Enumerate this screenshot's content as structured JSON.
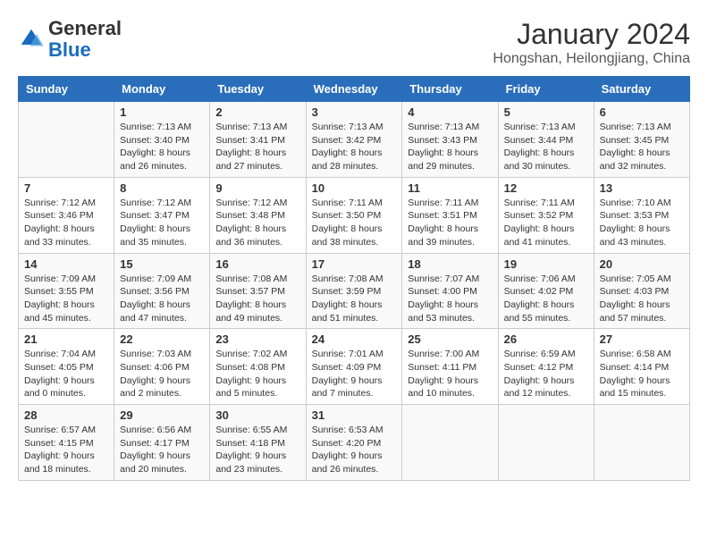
{
  "header": {
    "logo_line1": "General",
    "logo_line2": "Blue",
    "month": "January 2024",
    "location": "Hongshan, Heilongjiang, China"
  },
  "days_of_week": [
    "Sunday",
    "Monday",
    "Tuesday",
    "Wednesday",
    "Thursday",
    "Friday",
    "Saturday"
  ],
  "weeks": [
    [
      {
        "day": "",
        "info": ""
      },
      {
        "day": "1",
        "info": "Sunrise: 7:13 AM\nSunset: 3:40 PM\nDaylight: 8 hours\nand 26 minutes."
      },
      {
        "day": "2",
        "info": "Sunrise: 7:13 AM\nSunset: 3:41 PM\nDaylight: 8 hours\nand 27 minutes."
      },
      {
        "day": "3",
        "info": "Sunrise: 7:13 AM\nSunset: 3:42 PM\nDaylight: 8 hours\nand 28 minutes."
      },
      {
        "day": "4",
        "info": "Sunrise: 7:13 AM\nSunset: 3:43 PM\nDaylight: 8 hours\nand 29 minutes."
      },
      {
        "day": "5",
        "info": "Sunrise: 7:13 AM\nSunset: 3:44 PM\nDaylight: 8 hours\nand 30 minutes."
      },
      {
        "day": "6",
        "info": "Sunrise: 7:13 AM\nSunset: 3:45 PM\nDaylight: 8 hours\nand 32 minutes."
      }
    ],
    [
      {
        "day": "7",
        "info": "Sunrise: 7:12 AM\nSunset: 3:46 PM\nDaylight: 8 hours\nand 33 minutes."
      },
      {
        "day": "8",
        "info": "Sunrise: 7:12 AM\nSunset: 3:47 PM\nDaylight: 8 hours\nand 35 minutes."
      },
      {
        "day": "9",
        "info": "Sunrise: 7:12 AM\nSunset: 3:48 PM\nDaylight: 8 hours\nand 36 minutes."
      },
      {
        "day": "10",
        "info": "Sunrise: 7:11 AM\nSunset: 3:50 PM\nDaylight: 8 hours\nand 38 minutes."
      },
      {
        "day": "11",
        "info": "Sunrise: 7:11 AM\nSunset: 3:51 PM\nDaylight: 8 hours\nand 39 minutes."
      },
      {
        "day": "12",
        "info": "Sunrise: 7:11 AM\nSunset: 3:52 PM\nDaylight: 8 hours\nand 41 minutes."
      },
      {
        "day": "13",
        "info": "Sunrise: 7:10 AM\nSunset: 3:53 PM\nDaylight: 8 hours\nand 43 minutes."
      }
    ],
    [
      {
        "day": "14",
        "info": "Sunrise: 7:09 AM\nSunset: 3:55 PM\nDaylight: 8 hours\nand 45 minutes."
      },
      {
        "day": "15",
        "info": "Sunrise: 7:09 AM\nSunset: 3:56 PM\nDaylight: 8 hours\nand 47 minutes."
      },
      {
        "day": "16",
        "info": "Sunrise: 7:08 AM\nSunset: 3:57 PM\nDaylight: 8 hours\nand 49 minutes."
      },
      {
        "day": "17",
        "info": "Sunrise: 7:08 AM\nSunset: 3:59 PM\nDaylight: 8 hours\nand 51 minutes."
      },
      {
        "day": "18",
        "info": "Sunrise: 7:07 AM\nSunset: 4:00 PM\nDaylight: 8 hours\nand 53 minutes."
      },
      {
        "day": "19",
        "info": "Sunrise: 7:06 AM\nSunset: 4:02 PM\nDaylight: 8 hours\nand 55 minutes."
      },
      {
        "day": "20",
        "info": "Sunrise: 7:05 AM\nSunset: 4:03 PM\nDaylight: 8 hours\nand 57 minutes."
      }
    ],
    [
      {
        "day": "21",
        "info": "Sunrise: 7:04 AM\nSunset: 4:05 PM\nDaylight: 9 hours\nand 0 minutes."
      },
      {
        "day": "22",
        "info": "Sunrise: 7:03 AM\nSunset: 4:06 PM\nDaylight: 9 hours\nand 2 minutes."
      },
      {
        "day": "23",
        "info": "Sunrise: 7:02 AM\nSunset: 4:08 PM\nDaylight: 9 hours\nand 5 minutes."
      },
      {
        "day": "24",
        "info": "Sunrise: 7:01 AM\nSunset: 4:09 PM\nDaylight: 9 hours\nand 7 minutes."
      },
      {
        "day": "25",
        "info": "Sunrise: 7:00 AM\nSunset: 4:11 PM\nDaylight: 9 hours\nand 10 minutes."
      },
      {
        "day": "26",
        "info": "Sunrise: 6:59 AM\nSunset: 4:12 PM\nDaylight: 9 hours\nand 12 minutes."
      },
      {
        "day": "27",
        "info": "Sunrise: 6:58 AM\nSunset: 4:14 PM\nDaylight: 9 hours\nand 15 minutes."
      }
    ],
    [
      {
        "day": "28",
        "info": "Sunrise: 6:57 AM\nSunset: 4:15 PM\nDaylight: 9 hours\nand 18 minutes."
      },
      {
        "day": "29",
        "info": "Sunrise: 6:56 AM\nSunset: 4:17 PM\nDaylight: 9 hours\nand 20 minutes."
      },
      {
        "day": "30",
        "info": "Sunrise: 6:55 AM\nSunset: 4:18 PM\nDaylight: 9 hours\nand 23 minutes."
      },
      {
        "day": "31",
        "info": "Sunrise: 6:53 AM\nSunset: 4:20 PM\nDaylight: 9 hours\nand 26 minutes."
      },
      {
        "day": "",
        "info": ""
      },
      {
        "day": "",
        "info": ""
      },
      {
        "day": "",
        "info": ""
      }
    ]
  ]
}
